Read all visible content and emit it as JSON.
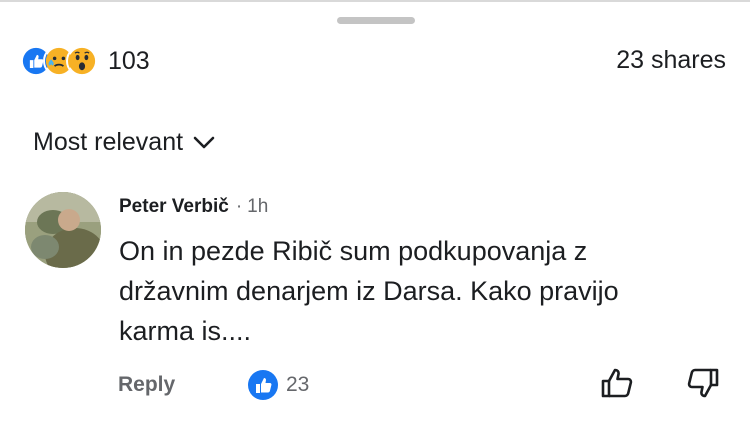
{
  "reactions": {
    "icons": [
      "like-icon",
      "care-icon",
      "wow-icon"
    ],
    "count": "103"
  },
  "shares": "23 shares",
  "sort": {
    "label": "Most relevant",
    "icon": "chevron-down-icon"
  },
  "comment": {
    "author": "Peter Verbič",
    "separator": "·",
    "time": "1h",
    "text_lines": [
      "On in pezde Ribič sum podkupovanja z",
      "državnim denarjem iz Darsa. Kako pravijo",
      "karma is...."
    ],
    "reply_label": "Reply",
    "like_count": "23"
  },
  "colors": {
    "facebook_blue": "#1877f2",
    "secondary_text": "#65676b",
    "primary_text": "#1c1e21"
  }
}
